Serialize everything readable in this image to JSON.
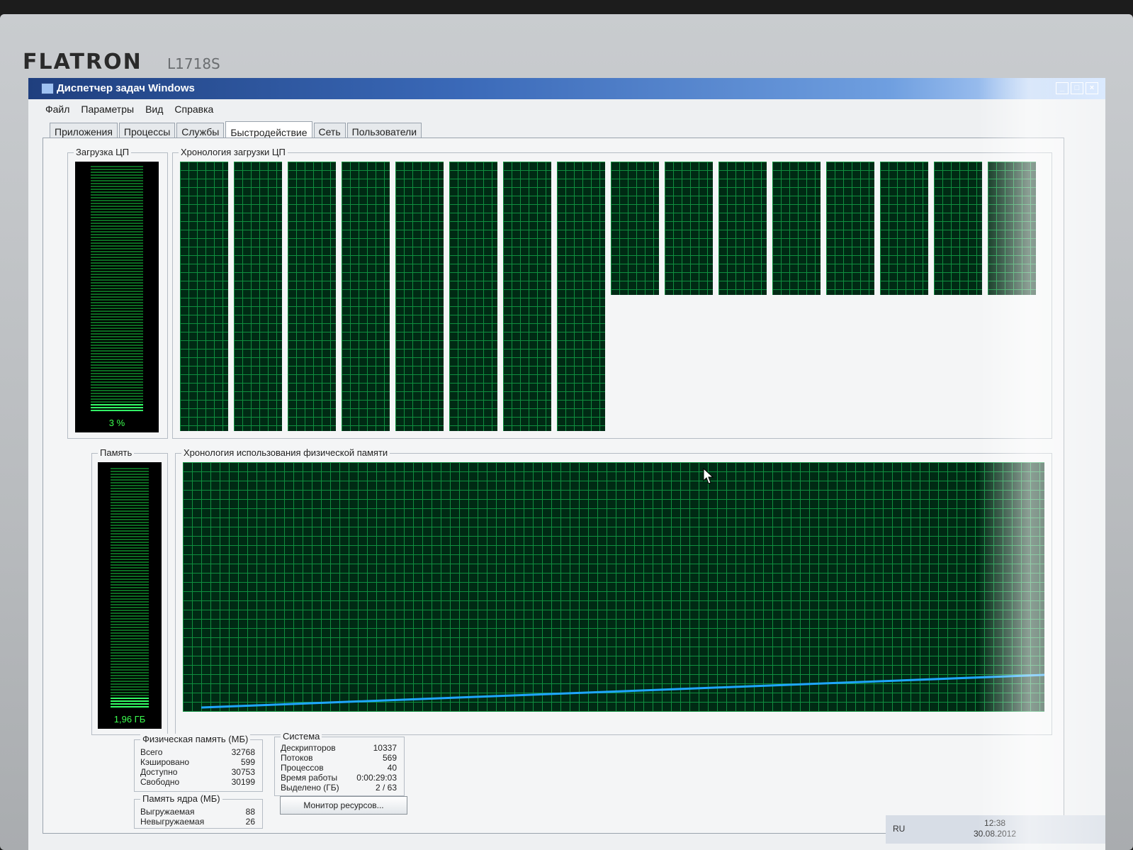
{
  "monitor": {
    "brand": "FLATRON",
    "model": "L1718S"
  },
  "window": {
    "title": "Диспетчер задач Windows",
    "controls": [
      "_",
      "□",
      "×"
    ]
  },
  "menu": [
    "Файл",
    "Параметры",
    "Вид",
    "Справка"
  ],
  "tabs": [
    "Приложения",
    "Процессы",
    "Службы",
    "Быстродействие",
    "Сеть",
    "Пользователи"
  ],
  "active_tab": "Быстродействие",
  "cpu": {
    "label": "Загрузка ЦП",
    "value": "3 %",
    "value_fraction": 0.03,
    "history_label": "Хронология загрузки ЦП",
    "core_count_visible": 16
  },
  "memory": {
    "label": "Память",
    "value": "1,96 ГБ",
    "history_label": "Хронология использования физической памяти"
  },
  "physical_memory": {
    "title": "Физическая память (МБ)",
    "rows": [
      {
        "label": "Всего",
        "value": "32768"
      },
      {
        "label": "Кэшировано",
        "value": "599"
      },
      {
        "label": "Доступно",
        "value": "30753"
      },
      {
        "label": "Свободно",
        "value": "30199"
      }
    ]
  },
  "kernel_memory": {
    "title": "Память ядра (МБ)",
    "rows": [
      {
        "label": "Выгружаемая",
        "value": "88"
      },
      {
        "label": "Невыгружаемая",
        "value": "26"
      }
    ]
  },
  "system": {
    "title": "Система",
    "rows": [
      {
        "label": "Дескрипторов",
        "value": "10337"
      },
      {
        "label": "Потоков",
        "value": "569"
      },
      {
        "label": "Процессов",
        "value": "40"
      },
      {
        "label": "Время работы",
        "value": "0:00:29:03"
      },
      {
        "label": "Выделено (ГБ)",
        "value": "2 / 63"
      }
    ]
  },
  "resource_monitor_button": "Монитор ресурсов...",
  "taskbar": {
    "language": "RU",
    "time": "12:38",
    "date": "30.08.2012"
  },
  "colors": {
    "graph_bg": "#002a14",
    "grid": "#0f8f3f",
    "meter_green": "#33ff66",
    "memory_line": "#1fa6ff",
    "title_bar": "#2a55a0"
  }
}
